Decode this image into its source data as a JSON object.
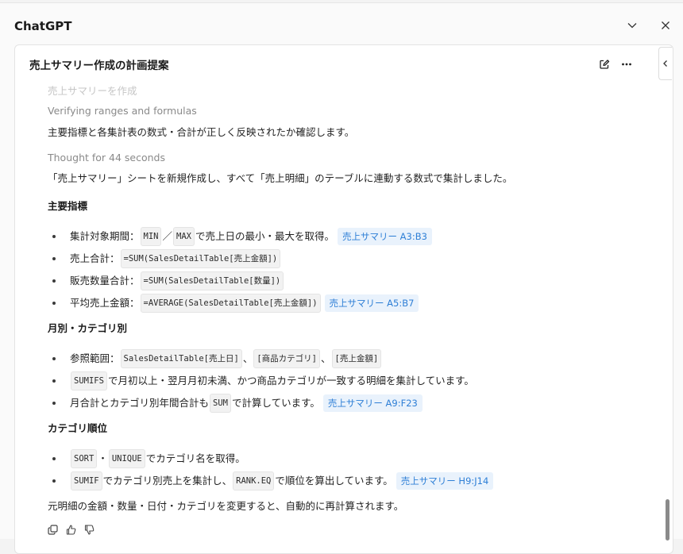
{
  "window": {
    "title": "ChatGPT"
  },
  "card": {
    "title": "売上サマリー作成の計画提案"
  },
  "steps": {
    "step1": "売上サマリーを作成",
    "step2": "Verifying ranges and formulas",
    "step2_detail": "主要指標と各集計表の数式・合計が正しく反映されたか確認します。",
    "thought": "Thought for 44 seconds"
  },
  "answer": {
    "intro": "「売上サマリー」シートを新規作成し、すべて「売上明細」のテーブルに連動する数式で集計しました。",
    "section1": {
      "heading": "主要指標",
      "b1": {
        "pre": "集計対象期間：",
        "c1": "MIN",
        "sep": "／",
        "c2": "MAX",
        "post": "で売上日の最小・最大を取得。",
        "link": "売上サマリー A3:B3"
      },
      "b2": {
        "pre": "売上合計：",
        "c1": "=SUM(SalesDetailTable[売上金額])"
      },
      "b3": {
        "pre": "販売数量合計：",
        "c1": "=SUM(SalesDetailTable[数量])"
      },
      "b4": {
        "pre": "平均売上金額：",
        "c1": "=AVERAGE(SalesDetailTable[売上金額])",
        "link": "売上サマリー A5:B7"
      }
    },
    "section2": {
      "heading": "月別・カテゴリ別",
      "b1": {
        "pre": "参照範囲：",
        "c1": "SalesDetailTable[売上日]",
        "sep1": "、",
        "c2": "[商品カテゴリ]",
        "sep2": "、",
        "c3": "[売上金額]"
      },
      "b2": {
        "c1": "SUMIFS",
        "post": "で月初以上・翌月月初未満、かつ商品カテゴリが一致する明細を集計しています。"
      },
      "b3": {
        "pre": "月合計とカテゴリ別年間合計も",
        "c1": "SUM",
        "post": "で計算しています。",
        "link": "売上サマリー A9:F23"
      }
    },
    "section3": {
      "heading": "カテゴリ順位",
      "b1": {
        "c1": "SORT",
        "sep": "・",
        "c2": "UNIQUE",
        "post": "でカテゴリ名を取得。"
      },
      "b2": {
        "c1": "SUMIF",
        "mid": "でカテゴリ別売上を集計し、",
        "c2": "RANK.EQ",
        "post": "で順位を算出しています。",
        "link": "売上サマリー H9:J14"
      }
    },
    "outro": "元明細の金額・数量・日付・カテゴリを変更すると、自動的に再計算されます。"
  },
  "icons": {
    "collapse": "chevron-down-icon",
    "close": "close-icon",
    "edit": "edit-icon",
    "more": "more-horizontal-icon",
    "sidebar": "chevron-left-icon",
    "copy": "copy-icon",
    "like": "thumbs-up-icon",
    "dislike": "thumbs-down-icon"
  }
}
